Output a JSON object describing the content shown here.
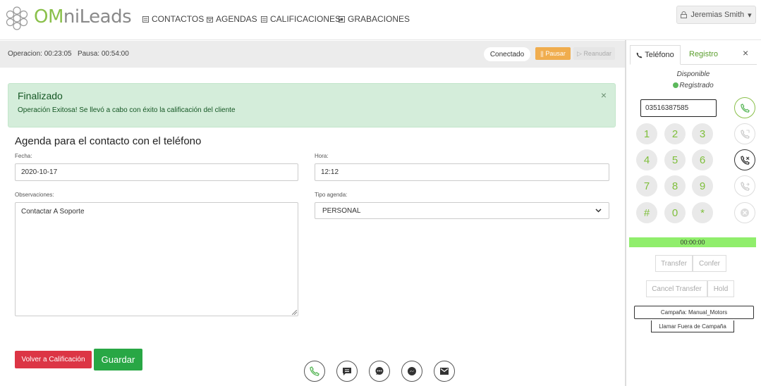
{
  "brand": {
    "prefix": "OM",
    "rest": "niLeads"
  },
  "nav": [
    {
      "label": "CONTACTOS",
      "icon": "list-icon",
      "caret": "⌄"
    },
    {
      "label": "AGENDAS",
      "icon": "calendar-icon"
    },
    {
      "label": "CALIFICACIONES",
      "icon": "list-icon"
    },
    {
      "label": "GRABACIONES",
      "icon": "recording-icon"
    }
  ],
  "user": {
    "name": "Jeremias Smith",
    "caret": "▾"
  },
  "status": {
    "operation": "Operacion: 00:23:05   Pausa: 00:54:00",
    "connection": "Conectado",
    "pause": "|| Pausar",
    "resume": "▷ Reanudar"
  },
  "alert": {
    "title": "Finalizado",
    "message": "Operación Exitosa! Se llevó a cabo con éxito la calificación del cliente",
    "close": "×"
  },
  "form": {
    "title": "Agenda para el contacto con el teléfono",
    "date_label": "Fecha:",
    "date_value": "2020-10-17",
    "time_label": "Hora:",
    "time_value": "12:12",
    "notes_label": "Observaciones:",
    "notes_value": "Contactar A Soporte",
    "type_label": "Tipo agenda:",
    "type_value": "PERSONAL",
    "back_button": "Volver a Calificación",
    "save_button": "Guardar"
  },
  "phone": {
    "tab_phone": "Teléfono",
    "tab_register": "Registro",
    "close": "×",
    "availability": "Disponible",
    "registration": "Registrado",
    "number": "03516387585",
    "keys": [
      "1",
      "2",
      "3",
      "4",
      "5",
      "6",
      "7",
      "8",
      "9",
      "#",
      "0",
      "*"
    ],
    "timer": "00:00:00",
    "transfer": "Transfer",
    "confer": "Confer",
    "cancel_transfer": "Cancel Transfer",
    "hold": "Hold",
    "campaign": "Campaña: Manual_Motors",
    "call_outside": "Llamar Fuera de Campaña"
  },
  "colors": {
    "accent": "#8ac04b",
    "success": "#28a745",
    "danger": "#dc3545",
    "warning": "#f0ad4e",
    "timer": "#90ee6c"
  }
}
